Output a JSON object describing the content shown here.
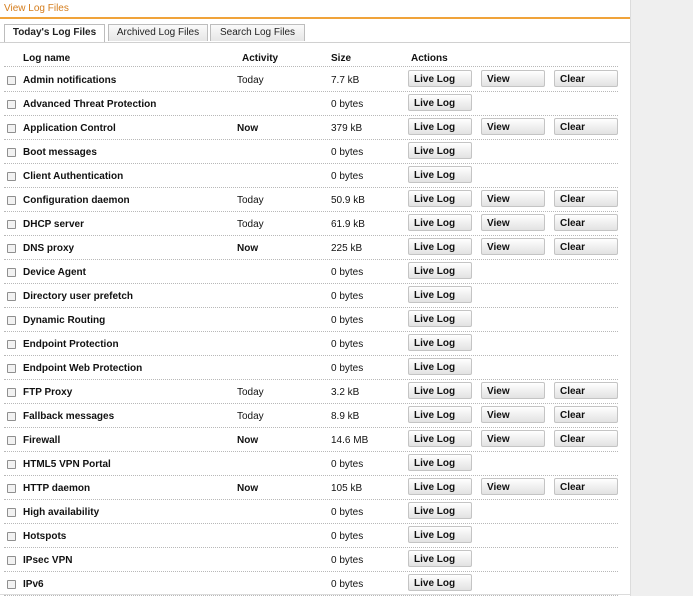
{
  "page": {
    "title": "View Log Files",
    "accent": "#f0a33a"
  },
  "tabs": [
    {
      "label": "Today's Log Files",
      "active": true
    },
    {
      "label": "Archived Log Files",
      "active": false
    },
    {
      "label": "Search Log Files",
      "active": false
    }
  ],
  "columns": {
    "name": "Log name",
    "activity": "Activity",
    "size": "Size",
    "actions": "Actions"
  },
  "buttons": {
    "live": "Live Log",
    "view": "View",
    "clear": "Clear"
  },
  "rows": [
    {
      "name": "Admin notifications",
      "activity": "Today",
      "size": "7.7 kB",
      "full": true
    },
    {
      "name": "Advanced Threat Protection",
      "activity": "",
      "size": "0 bytes",
      "full": false
    },
    {
      "name": "Application Control",
      "activity": "Now",
      "size": "379 kB",
      "full": true
    },
    {
      "name": "Boot messages",
      "activity": "",
      "size": "0 bytes",
      "full": false
    },
    {
      "name": "Client Authentication",
      "activity": "",
      "size": "0 bytes",
      "full": false
    },
    {
      "name": "Configuration daemon",
      "activity": "Today",
      "size": "50.9 kB",
      "full": true
    },
    {
      "name": "DHCP server",
      "activity": "Today",
      "size": "61.9 kB",
      "full": true
    },
    {
      "name": "DNS proxy",
      "activity": "Now",
      "size": "225 kB",
      "full": true
    },
    {
      "name": "Device Agent",
      "activity": "",
      "size": "0 bytes",
      "full": false
    },
    {
      "name": "Directory user prefetch",
      "activity": "",
      "size": "0 bytes",
      "full": false
    },
    {
      "name": "Dynamic Routing",
      "activity": "",
      "size": "0 bytes",
      "full": false
    },
    {
      "name": "Endpoint Protection",
      "activity": "",
      "size": "0 bytes",
      "full": false
    },
    {
      "name": "Endpoint Web Protection",
      "activity": "",
      "size": "0 bytes",
      "full": false
    },
    {
      "name": "FTP Proxy",
      "activity": "Today",
      "size": "3.2 kB",
      "full": true
    },
    {
      "name": "Fallback messages",
      "activity": "Today",
      "size": "8.9 kB",
      "full": true
    },
    {
      "name": "Firewall",
      "activity": "Now",
      "size": "14.6 MB",
      "full": true
    },
    {
      "name": "HTML5 VPN Portal",
      "activity": "",
      "size": "0 bytes",
      "full": false
    },
    {
      "name": "HTTP daemon",
      "activity": "Now",
      "size": "105 kB",
      "full": true
    },
    {
      "name": "High availability",
      "activity": "",
      "size": "0 bytes",
      "full": false
    },
    {
      "name": "Hotspots",
      "activity": "",
      "size": "0 bytes",
      "full": false
    },
    {
      "name": "IPsec VPN",
      "activity": "",
      "size": "0 bytes",
      "full": false
    },
    {
      "name": "IPv6",
      "activity": "",
      "size": "0 bytes",
      "full": false
    }
  ]
}
